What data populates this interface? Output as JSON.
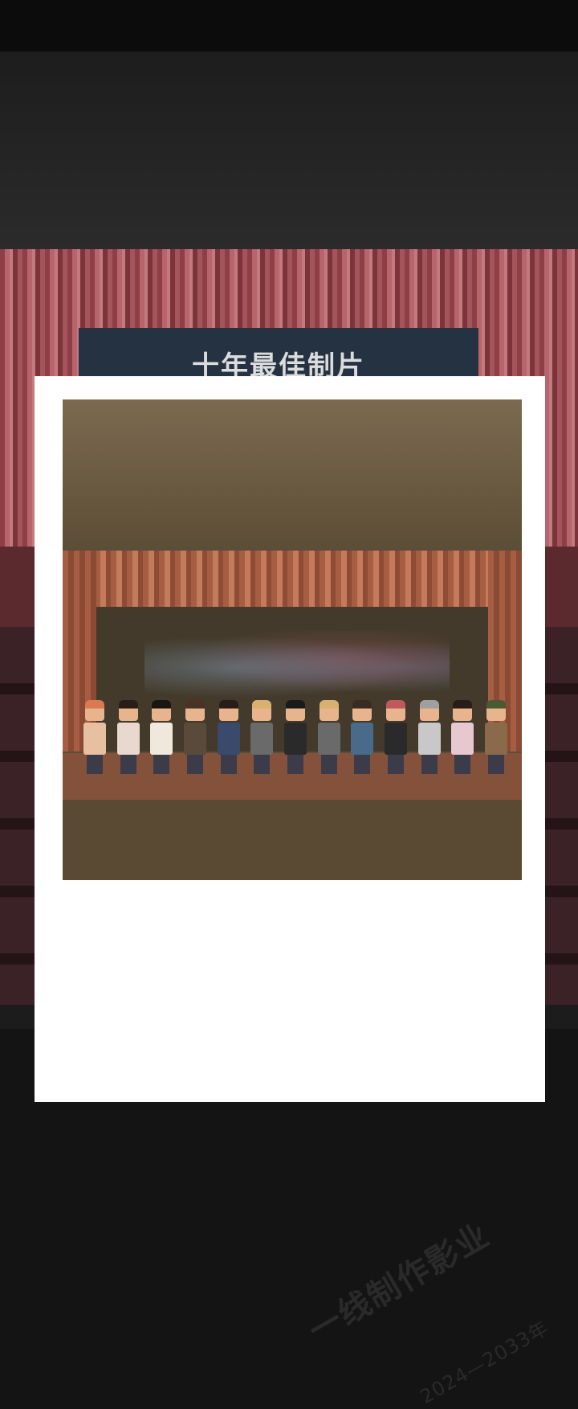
{
  "backdrop": {
    "screen_title": "十年最佳制片"
  },
  "polaroid": {
    "studio_name": "一线制作影业",
    "years": "2024—2033年"
  },
  "cast": [
    {
      "name": "cast-member-1",
      "hair": "#d97a52",
      "shirt": "#e6c0a0"
    },
    {
      "name": "cast-member-2",
      "hair": "#2a1d18",
      "shirt": "#e8d8d0"
    },
    {
      "name": "cast-member-3",
      "hair": "#1a1412",
      "shirt": "#f0e8dc"
    },
    {
      "name": "cast-member-4",
      "hair": "#4a3326",
      "shirt": "#5a4a3a"
    },
    {
      "name": "cast-member-5",
      "hair": "#2a1d18",
      "shirt": "#3a4a6a"
    },
    {
      "name": "cast-member-6",
      "hair": "#d8b070",
      "shirt": "#6a6a6a"
    },
    {
      "name": "cast-member-7",
      "hair": "#1a1a1a",
      "shirt": "#2a2a2a"
    },
    {
      "name": "cast-member-8",
      "hair": "#d8b070",
      "shirt": "#6a6a6a"
    },
    {
      "name": "cast-member-9",
      "hair": "#3a2a24",
      "shirt": "#4a6a8a"
    },
    {
      "name": "cast-member-10",
      "hair": "#c05a5a",
      "shirt": "#2a2a2a"
    },
    {
      "name": "cast-member-11",
      "hair": "#a0a0a0",
      "shirt": "#c8c8c8"
    },
    {
      "name": "cast-member-12",
      "hair": "#2a1d18",
      "shirt": "#e8c8d0"
    },
    {
      "name": "cast-member-13",
      "hair": "#4a5a30",
      "shirt": "#8a6a4a"
    }
  ]
}
